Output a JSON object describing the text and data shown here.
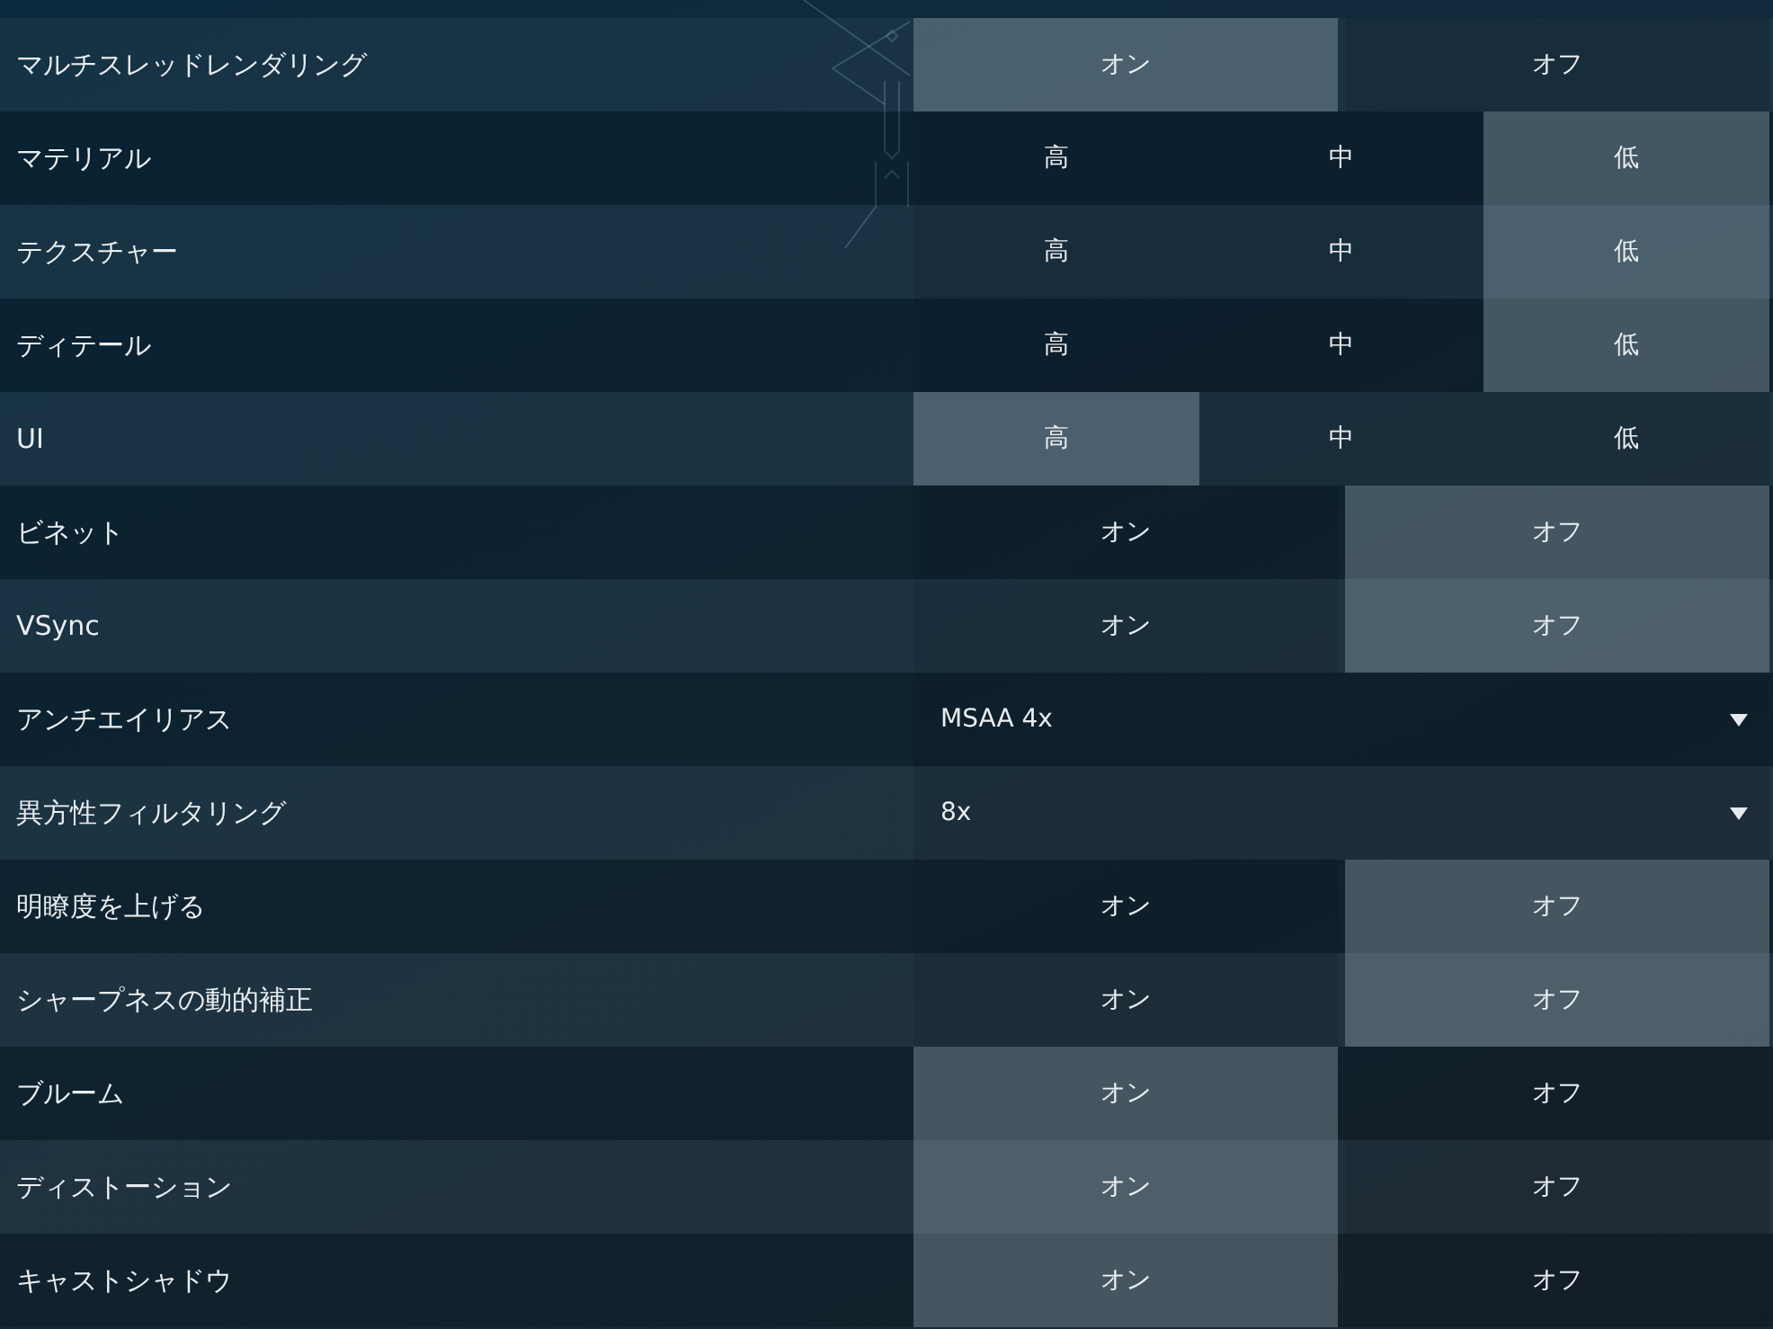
{
  "settings": [
    {
      "label": "マルチスレッドレンダリング",
      "kind": "toggle",
      "options": [
        {
          "label": "オン",
          "selected": true
        },
        {
          "label": "オフ",
          "selected": false
        }
      ]
    },
    {
      "label": "マテリアル",
      "kind": "level",
      "options": [
        {
          "label": "高",
          "selected": false
        },
        {
          "label": "中",
          "selected": false
        },
        {
          "label": "低",
          "selected": true
        }
      ]
    },
    {
      "label": "テクスチャー",
      "kind": "level",
      "options": [
        {
          "label": "高",
          "selected": false
        },
        {
          "label": "中",
          "selected": false
        },
        {
          "label": "低",
          "selected": true
        }
      ]
    },
    {
      "label": "ディテール",
      "kind": "level",
      "options": [
        {
          "label": "高",
          "selected": false
        },
        {
          "label": "中",
          "selected": false
        },
        {
          "label": "低",
          "selected": true
        }
      ]
    },
    {
      "label": "UI",
      "kind": "level",
      "options": [
        {
          "label": "高",
          "selected": true
        },
        {
          "label": "中",
          "selected": false
        },
        {
          "label": "低",
          "selected": false
        }
      ]
    },
    {
      "label": "ビネット",
      "kind": "toggle",
      "options": [
        {
          "label": "オン",
          "selected": false
        },
        {
          "label": "オフ",
          "selected": true
        }
      ]
    },
    {
      "label": "VSync",
      "kind": "toggle",
      "options": [
        {
          "label": "オン",
          "selected": false
        },
        {
          "label": "オフ",
          "selected": true
        }
      ]
    },
    {
      "label": "アンチエイリアス",
      "kind": "dropdown",
      "value": "MSAA 4x"
    },
    {
      "label": "異方性フィルタリング",
      "kind": "dropdown",
      "value": "8x"
    },
    {
      "label": "明瞭度を上げる",
      "kind": "toggle",
      "options": [
        {
          "label": "オン",
          "selected": false
        },
        {
          "label": "オフ",
          "selected": true
        }
      ]
    },
    {
      "label": "シャープネスの動的補正",
      "kind": "toggle",
      "options": [
        {
          "label": "オン",
          "selected": false
        },
        {
          "label": "オフ",
          "selected": true
        }
      ]
    },
    {
      "label": "ブルーム",
      "kind": "toggle",
      "options": [
        {
          "label": "オン",
          "selected": true
        },
        {
          "label": "オフ",
          "selected": false
        }
      ]
    },
    {
      "label": "ディストーション",
      "kind": "toggle",
      "options": [
        {
          "label": "オン",
          "selected": true
        },
        {
          "label": "オフ",
          "selected": false
        }
      ]
    },
    {
      "label": "キャストシャドウ",
      "kind": "toggle",
      "options": [
        {
          "label": "オン",
          "selected": true
        },
        {
          "label": "オフ",
          "selected": false
        }
      ]
    }
  ]
}
